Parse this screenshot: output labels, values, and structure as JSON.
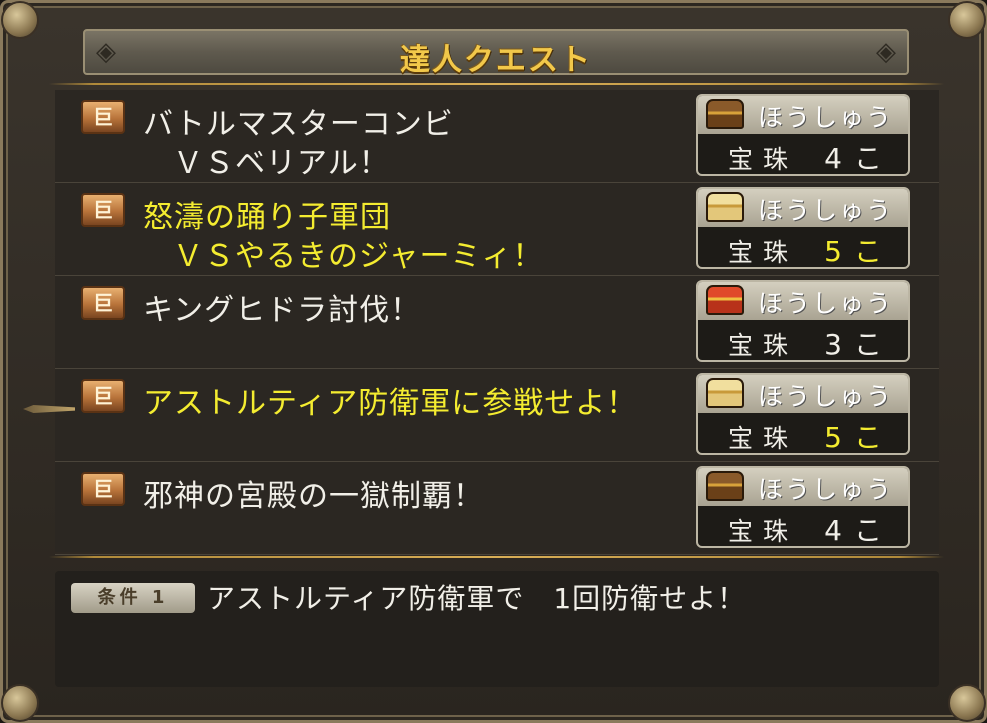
{
  "title": "達人クエスト",
  "quests": [
    {
      "line1": "バトルマスターコンビ",
      "line2": "ＶＳベリアル！",
      "highlight": false,
      "chest": "brown-chest-icon",
      "reward_label": "ほうしゅう",
      "reward_item": "宝珠",
      "reward_qty": "4こ"
    },
    {
      "line1": "怒濤の踊り子軍団",
      "line2": "ＶＳやるきのジャーミィ！",
      "highlight": true,
      "chest": "gold-chest-icon",
      "reward_label": "ほうしゅう",
      "reward_item": "宝珠",
      "reward_qty": "5こ"
    },
    {
      "line1": "キングヒドラ討伐！",
      "line2": "",
      "highlight": false,
      "chest": "red-chest-icon",
      "reward_label": "ほうしゅう",
      "reward_item": "宝珠",
      "reward_qty": "3こ"
    },
    {
      "line1": "アストルティア防衛軍に参戦せよ！",
      "line2": "",
      "highlight": true,
      "chest": "gold-chest-icon",
      "reward_label": "ほうしゅう",
      "reward_item": "宝珠",
      "reward_qty": "5こ"
    },
    {
      "line1": "邪神の宮殿の一獄制覇！",
      "line2": "",
      "highlight": false,
      "chest": "brown-chest-icon",
      "reward_label": "ほうしゅう",
      "reward_item": "宝珠",
      "reward_qty": "4こ"
    }
  ],
  "condition": {
    "badge": "条件 1",
    "text": "アストルティア防衛軍で　1回防衛せよ！"
  },
  "colors": {
    "highlight_text": "#f4ec30",
    "normal_text": "#f1efe8",
    "title_text": "#f2c84a"
  }
}
